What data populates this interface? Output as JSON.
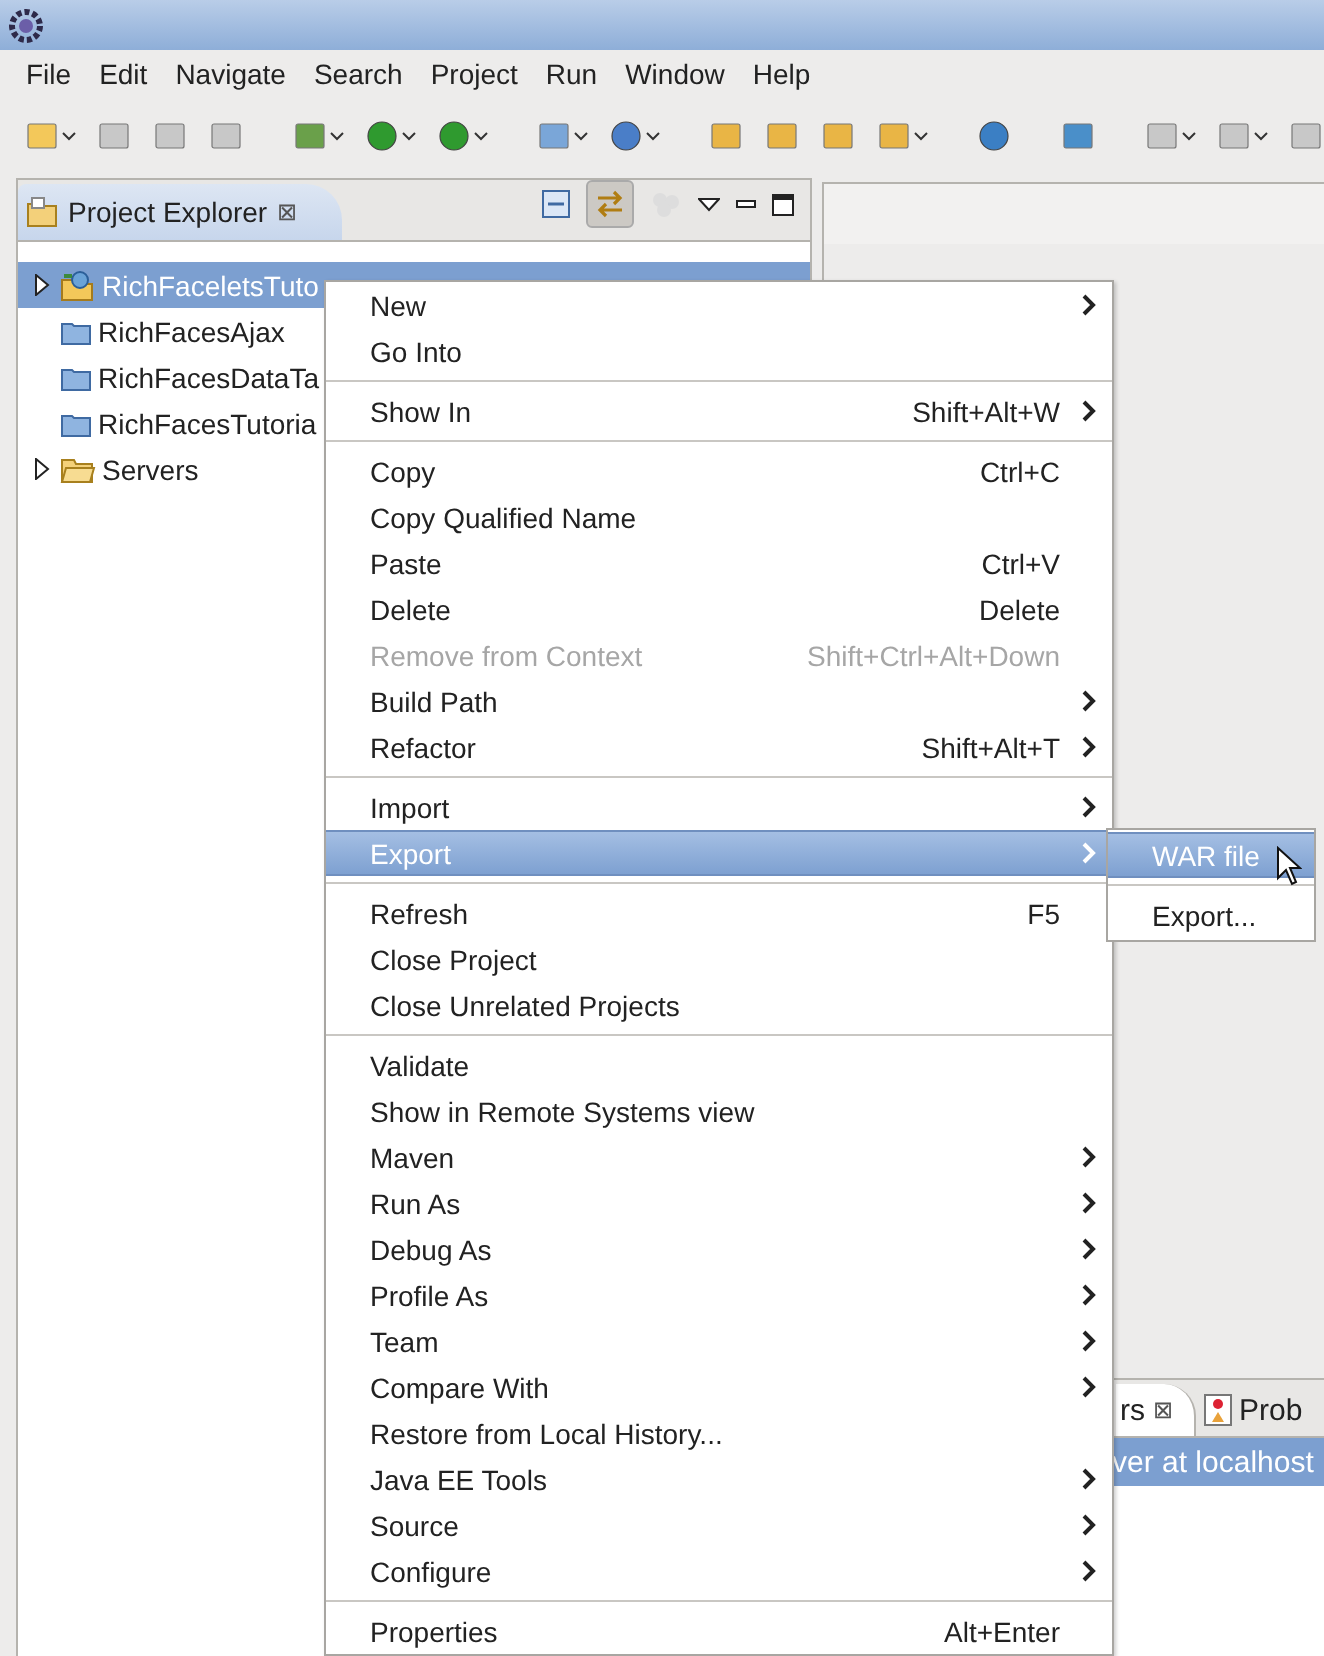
{
  "menubar": [
    {
      "label": "File"
    },
    {
      "label": "Edit"
    },
    {
      "label": "Navigate"
    },
    {
      "label": "Search"
    },
    {
      "label": "Project"
    },
    {
      "label": "Run"
    },
    {
      "label": "Window"
    },
    {
      "label": "Help"
    }
  ],
  "explorer": {
    "title": "Project Explorer",
    "close": "⊠",
    "tree": [
      {
        "label": "RichFaceletsTuto",
        "kind": "web",
        "expanded": false,
        "selected": true
      },
      {
        "label": "RichFacesAjax",
        "kind": "project",
        "selected": false
      },
      {
        "label": "RichFacesDataTa",
        "kind": "project",
        "selected": false
      },
      {
        "label": "RichFacesTutoria",
        "kind": "project",
        "selected": false
      },
      {
        "label": "Servers",
        "kind": "folder",
        "expanded": false,
        "selected": false
      }
    ]
  },
  "bottom_panel": {
    "tabs": [
      {
        "label": "rs",
        "close": "⊠",
        "selected": true
      },
      {
        "label": "Prob",
        "selected": false
      }
    ],
    "row": {
      "label": "ver at localhost",
      "selected": true
    }
  },
  "context_menu": [
    {
      "kind": "item",
      "label": "New",
      "submenu": true,
      "disabled": false,
      "selected": false
    },
    {
      "kind": "item",
      "label": "Go Into",
      "submenu": false,
      "disabled": false,
      "selected": false
    },
    {
      "kind": "separator"
    },
    {
      "kind": "item",
      "label": "Show In",
      "shortcut": "Shift+Alt+W",
      "submenu": true,
      "disabled": false,
      "selected": false
    },
    {
      "kind": "separator"
    },
    {
      "kind": "item",
      "label": "Copy",
      "shortcut": "Ctrl+C",
      "submenu": false,
      "disabled": false,
      "selected": false
    },
    {
      "kind": "item",
      "label": "Copy Qualified Name",
      "submenu": false,
      "disabled": false,
      "selected": false
    },
    {
      "kind": "item",
      "label": "Paste",
      "shortcut": "Ctrl+V",
      "submenu": false,
      "disabled": false,
      "selected": false
    },
    {
      "kind": "item",
      "label": "Delete",
      "shortcut": "Delete",
      "submenu": false,
      "disabled": false,
      "selected": false
    },
    {
      "kind": "item",
      "label": "Remove from Context",
      "shortcut": "Shift+Ctrl+Alt+Down",
      "submenu": false,
      "disabled": true,
      "selected": false
    },
    {
      "kind": "item",
      "label": "Build Path",
      "submenu": true,
      "disabled": false,
      "selected": false
    },
    {
      "kind": "item",
      "label": "Refactor",
      "shortcut": "Shift+Alt+T",
      "submenu": true,
      "disabled": false,
      "selected": false
    },
    {
      "kind": "separator"
    },
    {
      "kind": "item",
      "label": "Import",
      "submenu": true,
      "disabled": false,
      "selected": false
    },
    {
      "kind": "item",
      "label": "Export",
      "submenu": true,
      "disabled": false,
      "selected": true
    },
    {
      "kind": "separator"
    },
    {
      "kind": "item",
      "label": "Refresh",
      "shortcut": "F5",
      "submenu": false,
      "disabled": false,
      "selected": false
    },
    {
      "kind": "item",
      "label": "Close Project",
      "submenu": false,
      "disabled": false,
      "selected": false
    },
    {
      "kind": "item",
      "label": "Close Unrelated Projects",
      "submenu": false,
      "disabled": false,
      "selected": false
    },
    {
      "kind": "separator"
    },
    {
      "kind": "item",
      "label": "Validate",
      "submenu": false,
      "disabled": false,
      "selected": false
    },
    {
      "kind": "item",
      "label": "Show in Remote Systems view",
      "submenu": false,
      "disabled": false,
      "selected": false
    },
    {
      "kind": "item",
      "label": "Maven",
      "submenu": true,
      "disabled": false,
      "selected": false
    },
    {
      "kind": "item",
      "label": "Run As",
      "submenu": true,
      "disabled": false,
      "selected": false
    },
    {
      "kind": "item",
      "label": "Debug As",
      "submenu": true,
      "disabled": false,
      "selected": false
    },
    {
      "kind": "item",
      "label": "Profile As",
      "submenu": true,
      "disabled": false,
      "selected": false
    },
    {
      "kind": "item",
      "label": "Team",
      "submenu": true,
      "disabled": false,
      "selected": false
    },
    {
      "kind": "item",
      "label": "Compare With",
      "submenu": true,
      "disabled": false,
      "selected": false
    },
    {
      "kind": "item",
      "label": "Restore from Local History...",
      "submenu": false,
      "disabled": false,
      "selected": false
    },
    {
      "kind": "item",
      "label": "Java EE Tools",
      "submenu": true,
      "disabled": false,
      "selected": false
    },
    {
      "kind": "item",
      "label": "Source",
      "submenu": true,
      "disabled": false,
      "selected": false
    },
    {
      "kind": "item",
      "label": "Configure",
      "submenu": true,
      "disabled": false,
      "selected": false
    },
    {
      "kind": "separator"
    },
    {
      "kind": "item",
      "label": "Properties",
      "shortcut": "Alt+Enter",
      "submenu": false,
      "disabled": false,
      "selected": false
    }
  ],
  "submenu": [
    {
      "kind": "item",
      "label": "WAR file",
      "selected": true
    },
    {
      "kind": "separator"
    },
    {
      "kind": "item",
      "label": "Export...",
      "selected": false
    }
  ]
}
